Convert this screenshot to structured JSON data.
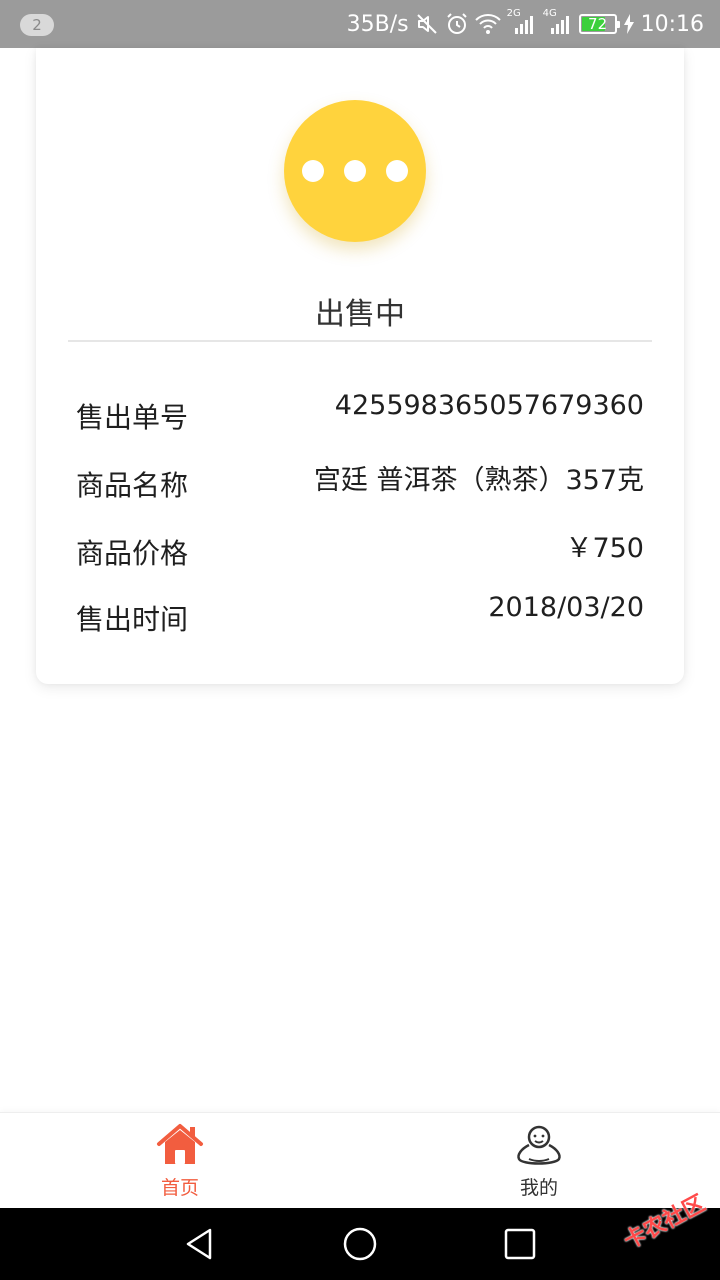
{
  "status_bar": {
    "notification_count": "2",
    "network_speed": "35B/s",
    "signal_2g": "2G",
    "signal_4g": "4G",
    "battery_percent": "72",
    "battery_level": 0.72,
    "time": "10:16"
  },
  "order": {
    "status": "出售中",
    "status_color": "#ffd33d",
    "rows": [
      {
        "label": "售出单号",
        "value": "425598365057679360"
      },
      {
        "label": "商品名称",
        "value": "宫廷 普洱茶（熟茶）357克"
      },
      {
        "label": "商品价格",
        "value": "￥750"
      },
      {
        "label": "售出时间",
        "value": "2018/03/20"
      }
    ]
  },
  "tabs": [
    {
      "label": "首页",
      "active": true,
      "icon": "home-icon"
    },
    {
      "label": "我的",
      "active": false,
      "icon": "user-icon"
    }
  ],
  "accent_color": "#f25d3f",
  "watermark": "卡农社区"
}
